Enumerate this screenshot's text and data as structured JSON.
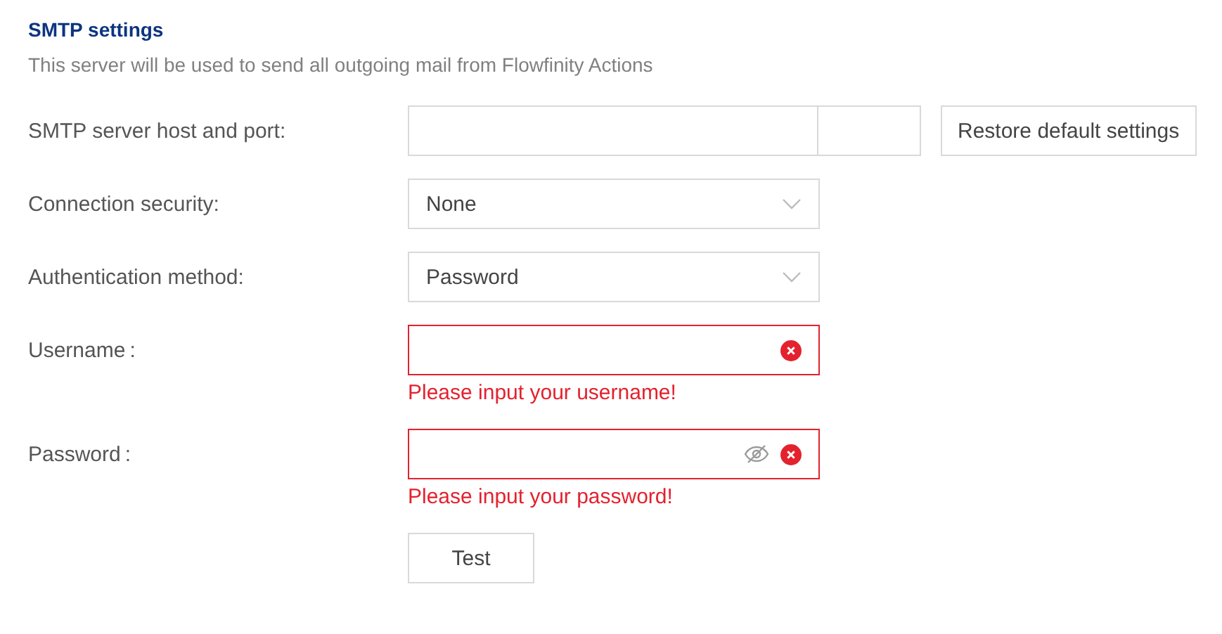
{
  "header": {
    "title": "SMTP settings",
    "subtitle": "This server will be used to send all outgoing mail from Flowfinity Actions"
  },
  "fields": [
    {
      "kind": "host_port",
      "label": "SMTP server host and port:",
      "button": "Restore default settings"
    },
    {
      "kind": "select",
      "label": "Connection security:",
      "value": "None"
    },
    {
      "kind": "select",
      "label": "Authentication method:",
      "value": "Password"
    },
    {
      "kind": "text",
      "label": "Username",
      "colon": ":",
      "invalid": true,
      "error": "Please input your username!"
    },
    {
      "kind": "password",
      "label": "Password",
      "colon": ":",
      "invalid": true,
      "error": "Please input your password!"
    }
  ],
  "test_button": "Test"
}
